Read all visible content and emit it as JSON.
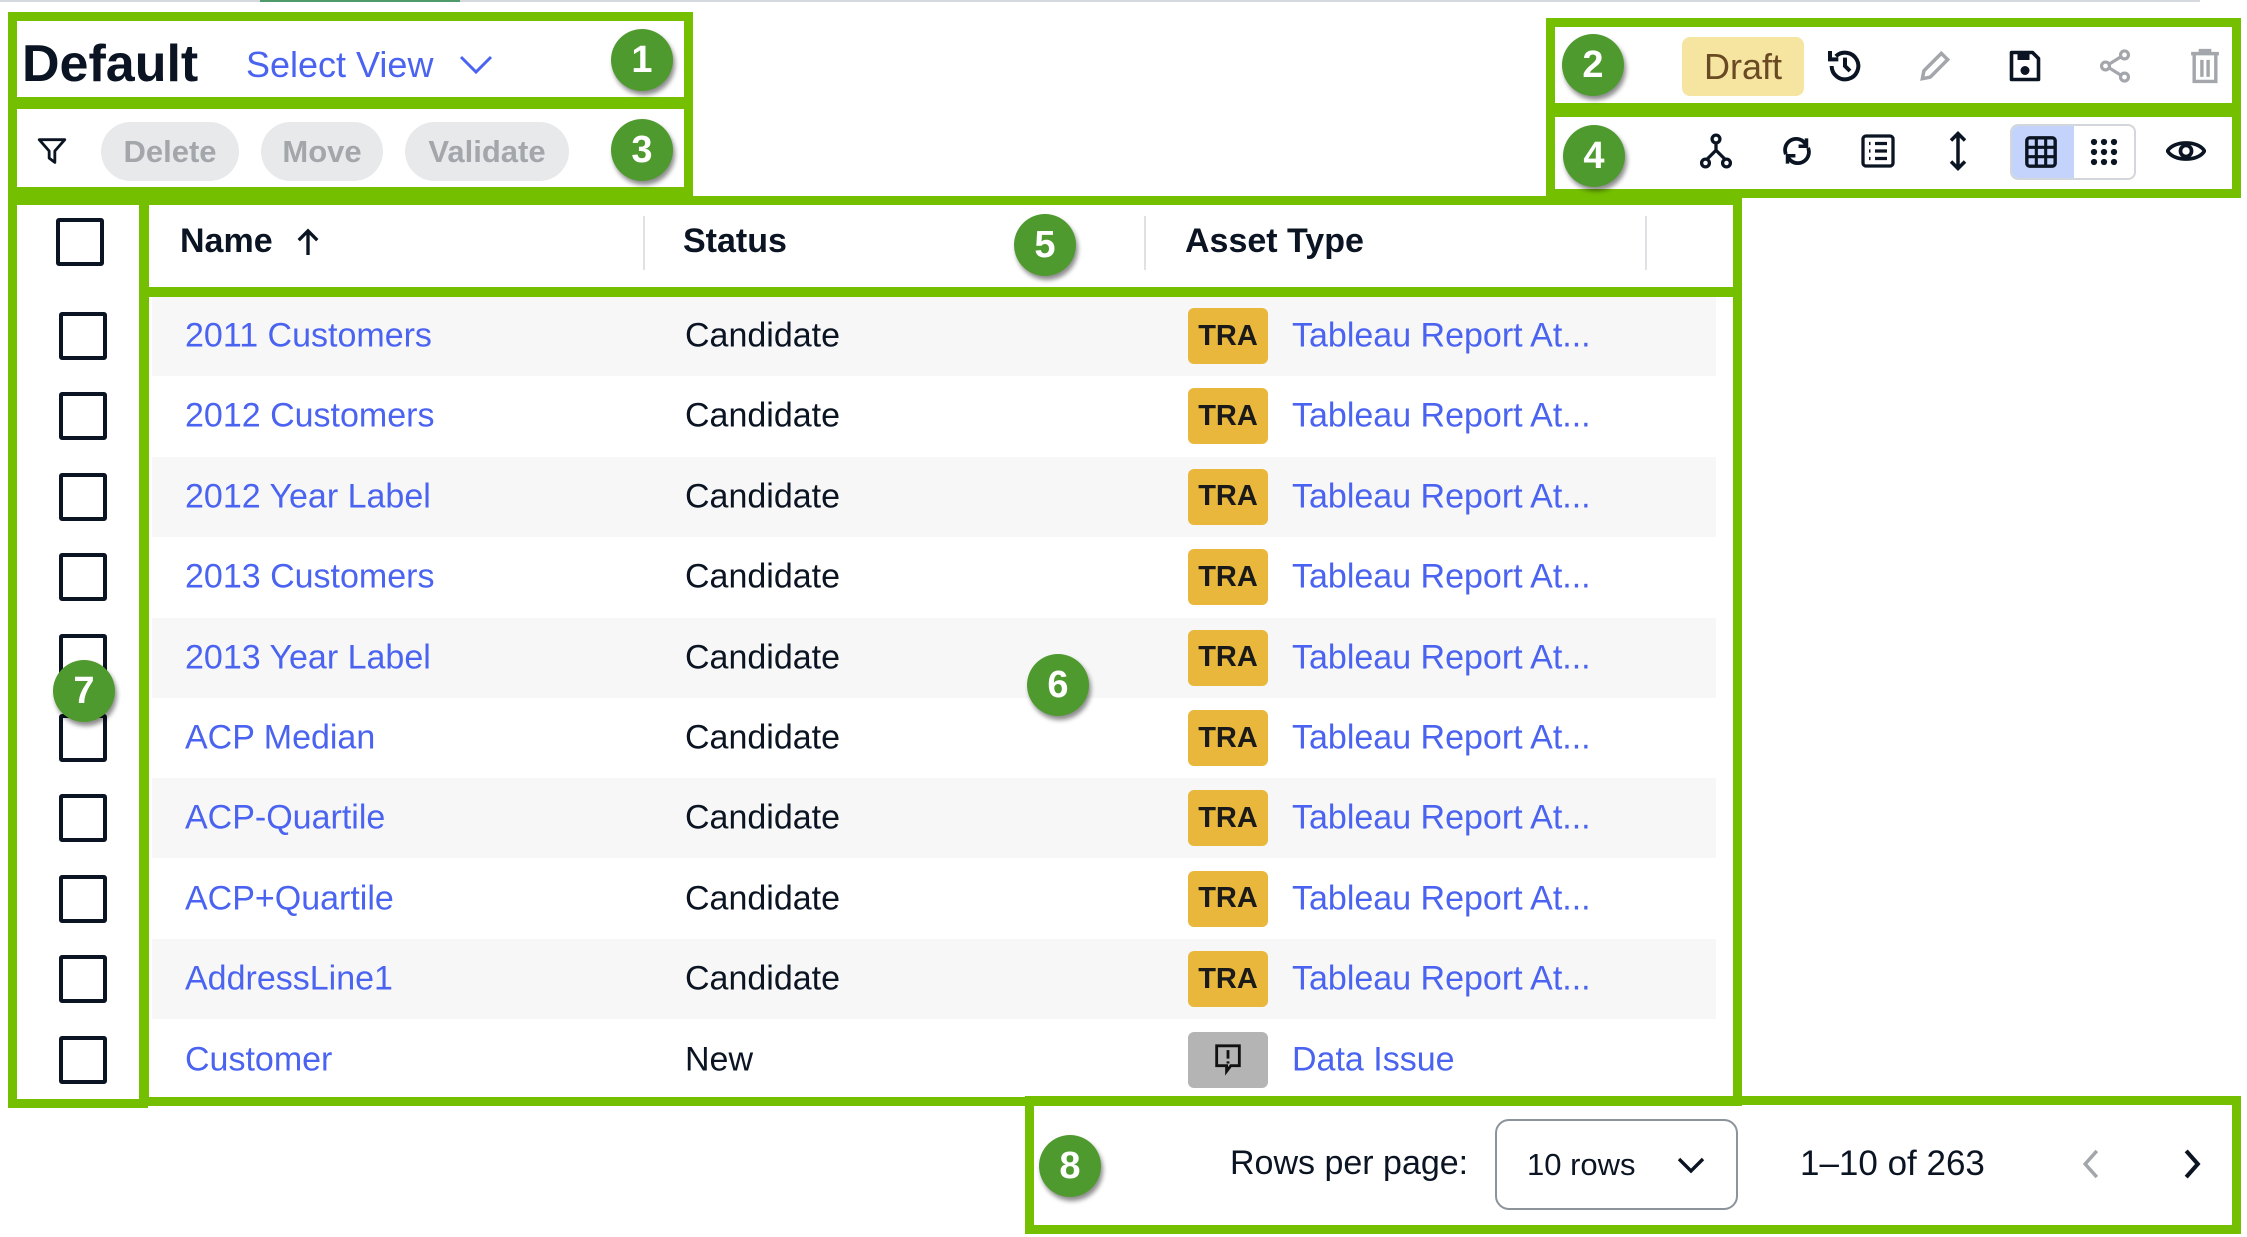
{
  "header": {
    "title": "Default",
    "select_view_label": "Select View"
  },
  "actions": {
    "delete_label": "Delete",
    "move_label": "Move",
    "validate_label": "Validate",
    "filter_icon": "filter-icon"
  },
  "toolbar": {
    "status_badge": "Draft",
    "status_color": "#f6e5a1",
    "icons": [
      "history-icon",
      "pencil-icon",
      "save-icon",
      "share-icon",
      "trash-icon"
    ],
    "view_icons": [
      "hierarchy-icon",
      "refresh-icon",
      "list-icon",
      "row-height-icon",
      "grid-view-icon",
      "dots-grid-icon",
      "eye-icon"
    ],
    "active_view": "grid-view"
  },
  "table": {
    "columns": {
      "name": "Name",
      "status": "Status",
      "asset_type": "Asset Type"
    },
    "sort": {
      "column": "Name",
      "direction": "ascending"
    },
    "rows": [
      {
        "name": "2011 Customers",
        "status": "Candidate",
        "badge": "TRA",
        "asset_type": "Tableau Report At..."
      },
      {
        "name": "2012 Customers",
        "status": "Candidate",
        "badge": "TRA",
        "asset_type": "Tableau Report At..."
      },
      {
        "name": "2012 Year Label",
        "status": "Candidate",
        "badge": "TRA",
        "asset_type": "Tableau Report At..."
      },
      {
        "name": "2013 Customers",
        "status": "Candidate",
        "badge": "TRA",
        "asset_type": "Tableau Report At..."
      },
      {
        "name": "2013 Year Label",
        "status": "Candidate",
        "badge": "TRA",
        "asset_type": "Tableau Report At..."
      },
      {
        "name": "ACP Median",
        "status": "Candidate",
        "badge": "TRA",
        "asset_type": "Tableau Report At..."
      },
      {
        "name": "ACP-Quartile",
        "status": "Candidate",
        "badge": "TRA",
        "asset_type": "Tableau Report At..."
      },
      {
        "name": "ACP+Quartile",
        "status": "Candidate",
        "badge": "TRA",
        "asset_type": "Tableau Report At..."
      },
      {
        "name": "AddressLine1",
        "status": "Candidate",
        "badge": "TRA",
        "asset_type": "Tableau Report At..."
      },
      {
        "name": "Customer",
        "status": "New",
        "badge": "",
        "badge_icon": "data-issue-icon",
        "asset_type": "Data Issue"
      }
    ]
  },
  "pagination": {
    "rows_per_page_label": "Rows per page:",
    "rows_per_page_value": "10 rows",
    "range": "1–10 of 263"
  },
  "annotations": [
    "1",
    "2",
    "3",
    "4",
    "5",
    "6",
    "7",
    "8"
  ],
  "colors": {
    "accent": "#4a63f0",
    "annotation_border": "#74bf00",
    "annotation_marker": "#4f9a2f",
    "badge_tra": "#e9b73c"
  }
}
